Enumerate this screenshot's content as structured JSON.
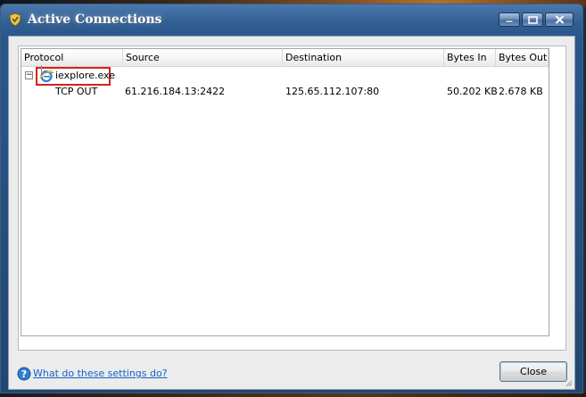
{
  "window": {
    "title": "Active Connections",
    "controls": {
      "minimize": "minimize",
      "maximize": "maximize",
      "close": "close"
    }
  },
  "columns": [
    "Protocol",
    "Source",
    "Destination",
    "Bytes In",
    "Bytes Out"
  ],
  "process": {
    "name": "iexplore.exe",
    "expander": "−",
    "icon": "internet-explorer-icon"
  },
  "connections": [
    {
      "protocol": "TCP OUT",
      "source": "61.216.184.13:2422",
      "destination": "125.65.112.107:80",
      "bytes_in": "50.202 KB",
      "bytes_out": "2.678 KB"
    }
  ],
  "footer": {
    "help_link": "What do these settings do?",
    "close_label": "Close"
  },
  "colors": {
    "highlight": "#d42020",
    "link": "#1463c7",
    "titlebar": "#2f5d92"
  }
}
